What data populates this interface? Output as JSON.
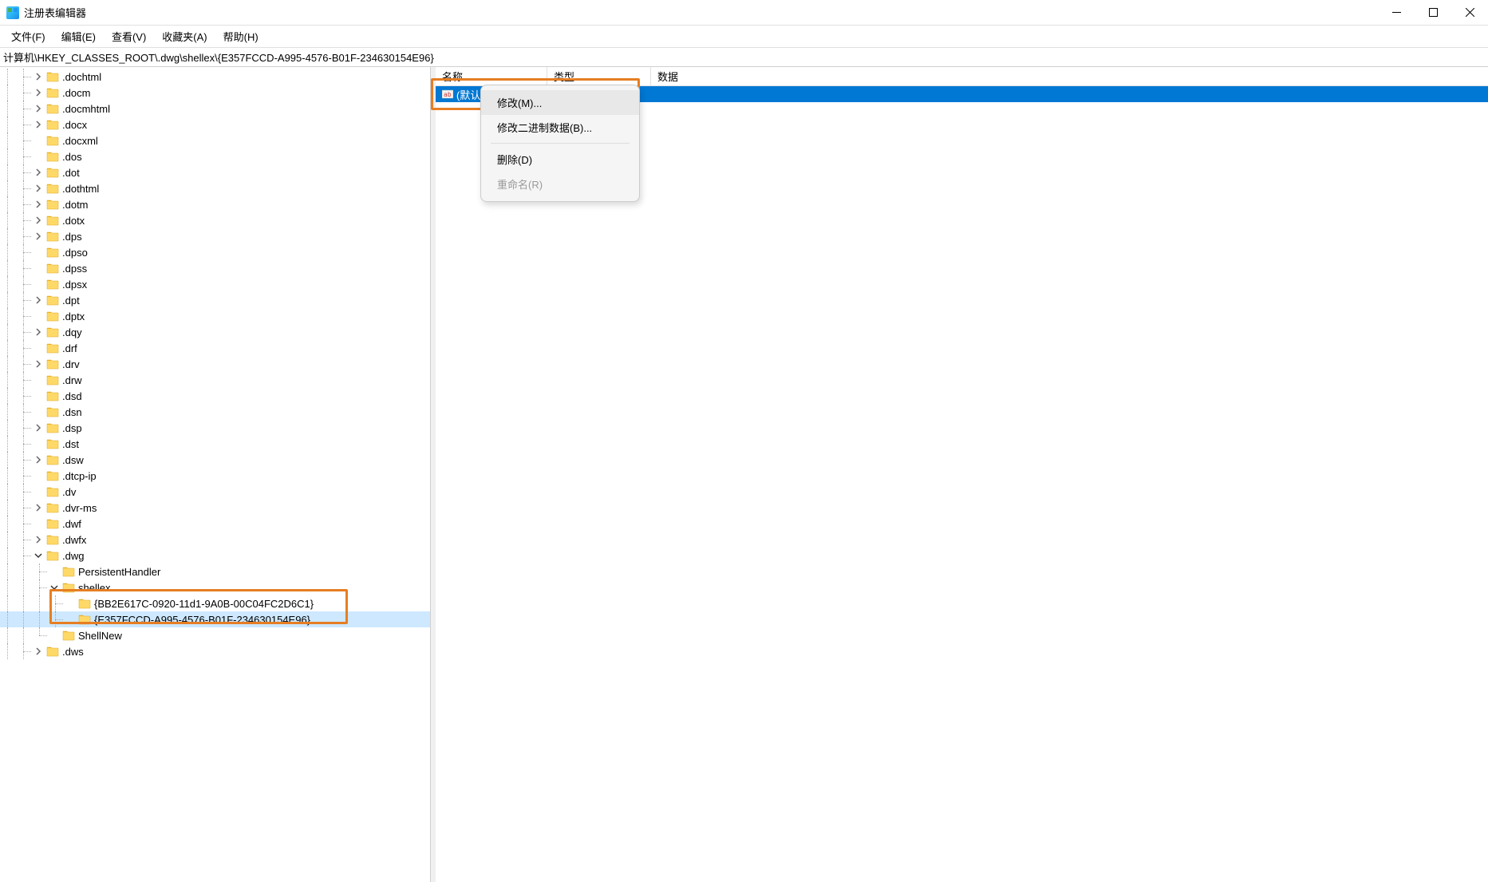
{
  "window": {
    "title": "注册表编辑器"
  },
  "menu": {
    "file": "文件(F)",
    "edit": "编辑(E)",
    "view": "查看(V)",
    "favorites": "收藏夹(A)",
    "help": "帮助(H)"
  },
  "address": "计算机\\HKEY_CLASSES_ROOT\\.dwg\\shellex\\{E357FCCD-A995-4576-B01F-234630154E96}",
  "tree_nodes": [
    {
      "label": ".dochtml",
      "indent": 2,
      "expandable": true
    },
    {
      "label": ".docm",
      "indent": 2,
      "expandable": true
    },
    {
      "label": ".docmhtml",
      "indent": 2,
      "expandable": true
    },
    {
      "label": ".docx",
      "indent": 2,
      "expandable": true
    },
    {
      "label": ".docxml",
      "indent": 2,
      "expandable": false
    },
    {
      "label": ".dos",
      "indent": 2,
      "expandable": false
    },
    {
      "label": ".dot",
      "indent": 2,
      "expandable": true
    },
    {
      "label": ".dothtml",
      "indent": 2,
      "expandable": true
    },
    {
      "label": ".dotm",
      "indent": 2,
      "expandable": true
    },
    {
      "label": ".dotx",
      "indent": 2,
      "expandable": true
    },
    {
      "label": ".dps",
      "indent": 2,
      "expandable": true
    },
    {
      "label": ".dpso",
      "indent": 2,
      "expandable": false
    },
    {
      "label": ".dpss",
      "indent": 2,
      "expandable": false
    },
    {
      "label": ".dpsx",
      "indent": 2,
      "expandable": false
    },
    {
      "label": ".dpt",
      "indent": 2,
      "expandable": true
    },
    {
      "label": ".dptx",
      "indent": 2,
      "expandable": false
    },
    {
      "label": ".dqy",
      "indent": 2,
      "expandable": true
    },
    {
      "label": ".drf",
      "indent": 2,
      "expandable": false
    },
    {
      "label": ".drv",
      "indent": 2,
      "expandable": true
    },
    {
      "label": ".drw",
      "indent": 2,
      "expandable": false
    },
    {
      "label": ".dsd",
      "indent": 2,
      "expandable": false
    },
    {
      "label": ".dsn",
      "indent": 2,
      "expandable": false
    },
    {
      "label": ".dsp",
      "indent": 2,
      "expandable": true
    },
    {
      "label": ".dst",
      "indent": 2,
      "expandable": false
    },
    {
      "label": ".dsw",
      "indent": 2,
      "expandable": true
    },
    {
      "label": ".dtcp-ip",
      "indent": 2,
      "expandable": false
    },
    {
      "label": ".dv",
      "indent": 2,
      "expandable": false
    },
    {
      "label": ".dvr-ms",
      "indent": 2,
      "expandable": true
    },
    {
      "label": ".dwf",
      "indent": 2,
      "expandable": false
    },
    {
      "label": ".dwfx",
      "indent": 2,
      "expandable": true
    },
    {
      "label": ".dwg",
      "indent": 2,
      "expandable": true,
      "expanded": true
    },
    {
      "label": "PersistentHandler",
      "indent": 3,
      "expandable": false
    },
    {
      "label": "shellex",
      "indent": 3,
      "expandable": true,
      "expanded": true
    },
    {
      "label": "{BB2E617C-0920-11d1-9A0B-00C04FC2D6C1}",
      "indent": 4,
      "expandable": false
    },
    {
      "label": "{E357FCCD-A995-4576-B01F-234630154E96}",
      "indent": 4,
      "expandable": false,
      "selected": true
    },
    {
      "label": "ShellNew",
      "indent": 3,
      "expandable": false,
      "last_sibling": true
    },
    {
      "label": ".dws",
      "indent": 2,
      "expandable": true
    }
  ],
  "list": {
    "headers": {
      "name": "名称",
      "type": "类型",
      "data": "数据"
    },
    "row": {
      "name": "(默认)",
      "selected": true
    }
  },
  "context_menu": {
    "modify": "修改(M)...",
    "modify_binary": "修改二进制数据(B)...",
    "delete": "删除(D)",
    "rename": "重命名(R)"
  }
}
